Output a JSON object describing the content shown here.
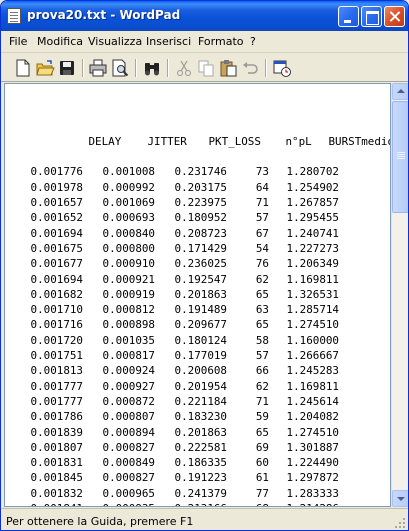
{
  "window": {
    "title": "prova20.txt - WordPad"
  },
  "menu": {
    "items": [
      "File",
      "Modifica",
      "Visualizza",
      "Inserisci",
      "Formato",
      "?"
    ]
  },
  "toolbar": {
    "tools": [
      "new-document",
      "open",
      "save",
      "print",
      "print-preview",
      "find",
      "cut",
      "copy",
      "paste",
      "undo",
      "insert-date-time"
    ]
  },
  "table": {
    "headers": [
      "DELAY",
      "JITTER",
      "PKT_LOSS",
      "n°pL",
      "BURSTmedio"
    ],
    "rows": [
      [
        "0.001776",
        "0.001008",
        "0.231746",
        "73",
        "1.280702"
      ],
      [
        "0.001978",
        "0.000992",
        "0.203175",
        "64",
        "1.254902"
      ],
      [
        "0.001657",
        "0.001069",
        "0.223975",
        "71",
        "1.267857"
      ],
      [
        "0.001652",
        "0.000693",
        "0.180952",
        "57",
        "1.295455"
      ],
      [
        "0.001694",
        "0.000840",
        "0.208723",
        "67",
        "1.240741"
      ],
      [
        "0.001675",
        "0.000800",
        "0.171429",
        "54",
        "1.227273"
      ],
      [
        "0.001677",
        "0.000910",
        "0.236025",
        "76",
        "1.206349"
      ],
      [
        "0.001694",
        "0.000921",
        "0.192547",
        "62",
        "1.169811"
      ],
      [
        "0.001682",
        "0.000919",
        "0.201863",
        "65",
        "1.326531"
      ],
      [
        "0.001710",
        "0.000812",
        "0.191489",
        "63",
        "1.285714"
      ],
      [
        "0.001716",
        "0.000898",
        "0.209677",
        "65",
        "1.274510"
      ],
      [
        "0.001720",
        "0.001035",
        "0.180124",
        "58",
        "1.160000"
      ],
      [
        "0.001751",
        "0.000817",
        "0.177019",
        "57",
        "1.266667"
      ],
      [
        "0.001813",
        "0.000924",
        "0.200608",
        "66",
        "1.245283"
      ],
      [
        "0.001777",
        "0.000927",
        "0.201954",
        "62",
        "1.169811"
      ],
      [
        "0.001777",
        "0.000872",
        "0.221184",
        "71",
        "1.245614"
      ],
      [
        "0.001786",
        "0.000807",
        "0.183230",
        "59",
        "1.204082"
      ],
      [
        "0.001839",
        "0.000894",
        "0.201863",
        "65",
        "1.274510"
      ],
      [
        "0.001807",
        "0.000827",
        "0.222581",
        "69",
        "1.301887"
      ],
      [
        "0.001831",
        "0.000849",
        "0.186335",
        "60",
        "1.224490"
      ],
      [
        "0.001845",
        "0.000827",
        "0.191223",
        "61",
        "1.297872"
      ],
      [
        "0.001832",
        "0.000965",
        "0.241379",
        "77",
        "1.283333"
      ],
      [
        "0.001841",
        "0.000935",
        "0.213166",
        "68",
        "1.214286"
      ],
      [
        "0.001859",
        "0.000983",
        "0.211180",
        "68",
        "1.236364"
      ],
      [
        "0.001853",
        "0.000932",
        "0.204969",
        "66",
        "1.157895"
      ]
    ]
  },
  "statusbar": {
    "text": "Per ottenere la Guida, premere F1"
  },
  "colors": {
    "titlebar": "#0a52d8",
    "close_button": "#d9502a",
    "window_bg": "#ece9d8",
    "document_bg": "#ffffff"
  }
}
